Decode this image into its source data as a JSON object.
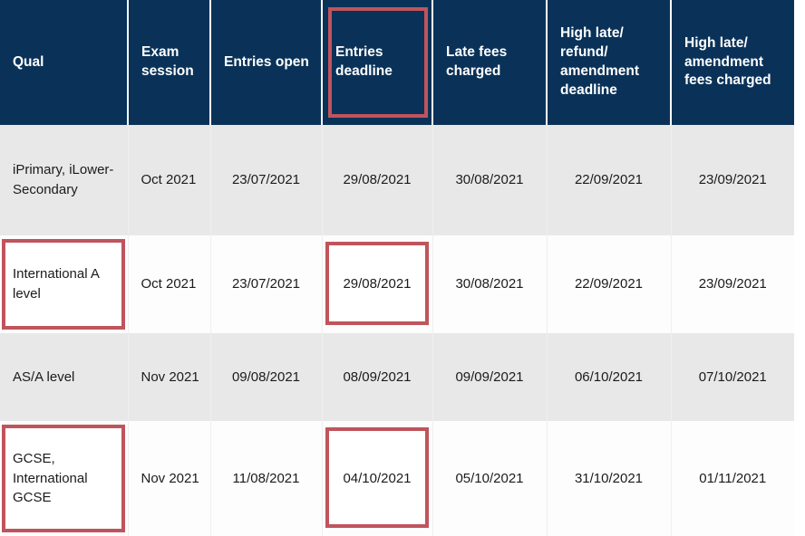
{
  "table": {
    "name": "exam-entry-deadlines-table",
    "columns": [
      {
        "key": "qual",
        "label": "Qual"
      },
      {
        "key": "exam_session",
        "label": "Exam session"
      },
      {
        "key": "entries_open",
        "label": "Entries open"
      },
      {
        "key": "entries_deadline",
        "label": "Entries deadline"
      },
      {
        "key": "late_fees",
        "label": "Late fees charged"
      },
      {
        "key": "high_late_deadline",
        "label": "High late/ refund/ amendment deadline"
      },
      {
        "key": "high_late_fees",
        "label": "High late/ amendment fees charged"
      }
    ],
    "rows": [
      {
        "qual": "iPrimary, iLower-Secondary",
        "exam_session": "Oct 2021",
        "entries_open": "23/07/2021",
        "entries_deadline": "29/08/2021",
        "late_fees": "30/08/2021",
        "high_late_deadline": "22/09/2021",
        "high_late_fees": "23/09/2021"
      },
      {
        "qual": "International A level",
        "exam_session": "Oct 2021",
        "entries_open": "23/07/2021",
        "entries_deadline": "29/08/2021",
        "late_fees": "30/08/2021",
        "high_late_deadline": "22/09/2021",
        "high_late_fees": "23/09/2021"
      },
      {
        "qual": "AS/A level",
        "exam_session": "Nov 2021",
        "entries_open": "09/08/2021",
        "entries_deadline": "08/09/2021",
        "late_fees": "09/09/2021",
        "high_late_deadline": "06/10/2021",
        "high_late_fees": "07/10/2021"
      },
      {
        "qual": "GCSE, International GCSE",
        "exam_session": "Nov 2021",
        "entries_open": "11/08/2021",
        "entries_deadline": "04/10/2021",
        "late_fees": "05/10/2021",
        "high_late_deadline": "31/10/2021",
        "high_late_fees": "01/11/2021"
      }
    ]
  },
  "annotations": {
    "highlight_color": "#c0545c",
    "highlighted_cells": [
      "header.entries_deadline",
      "row1.qual",
      "row1.entries_deadline",
      "row3.qual",
      "row3.entries_deadline"
    ]
  },
  "colors": {
    "header_background": "#0a3258",
    "header_text": "#ffffff",
    "row_odd_background": "#e8e8e8",
    "row_even_background": "#fdfdfd",
    "body_text": "#1b1b1b",
    "cell_divider": "#efefef"
  }
}
